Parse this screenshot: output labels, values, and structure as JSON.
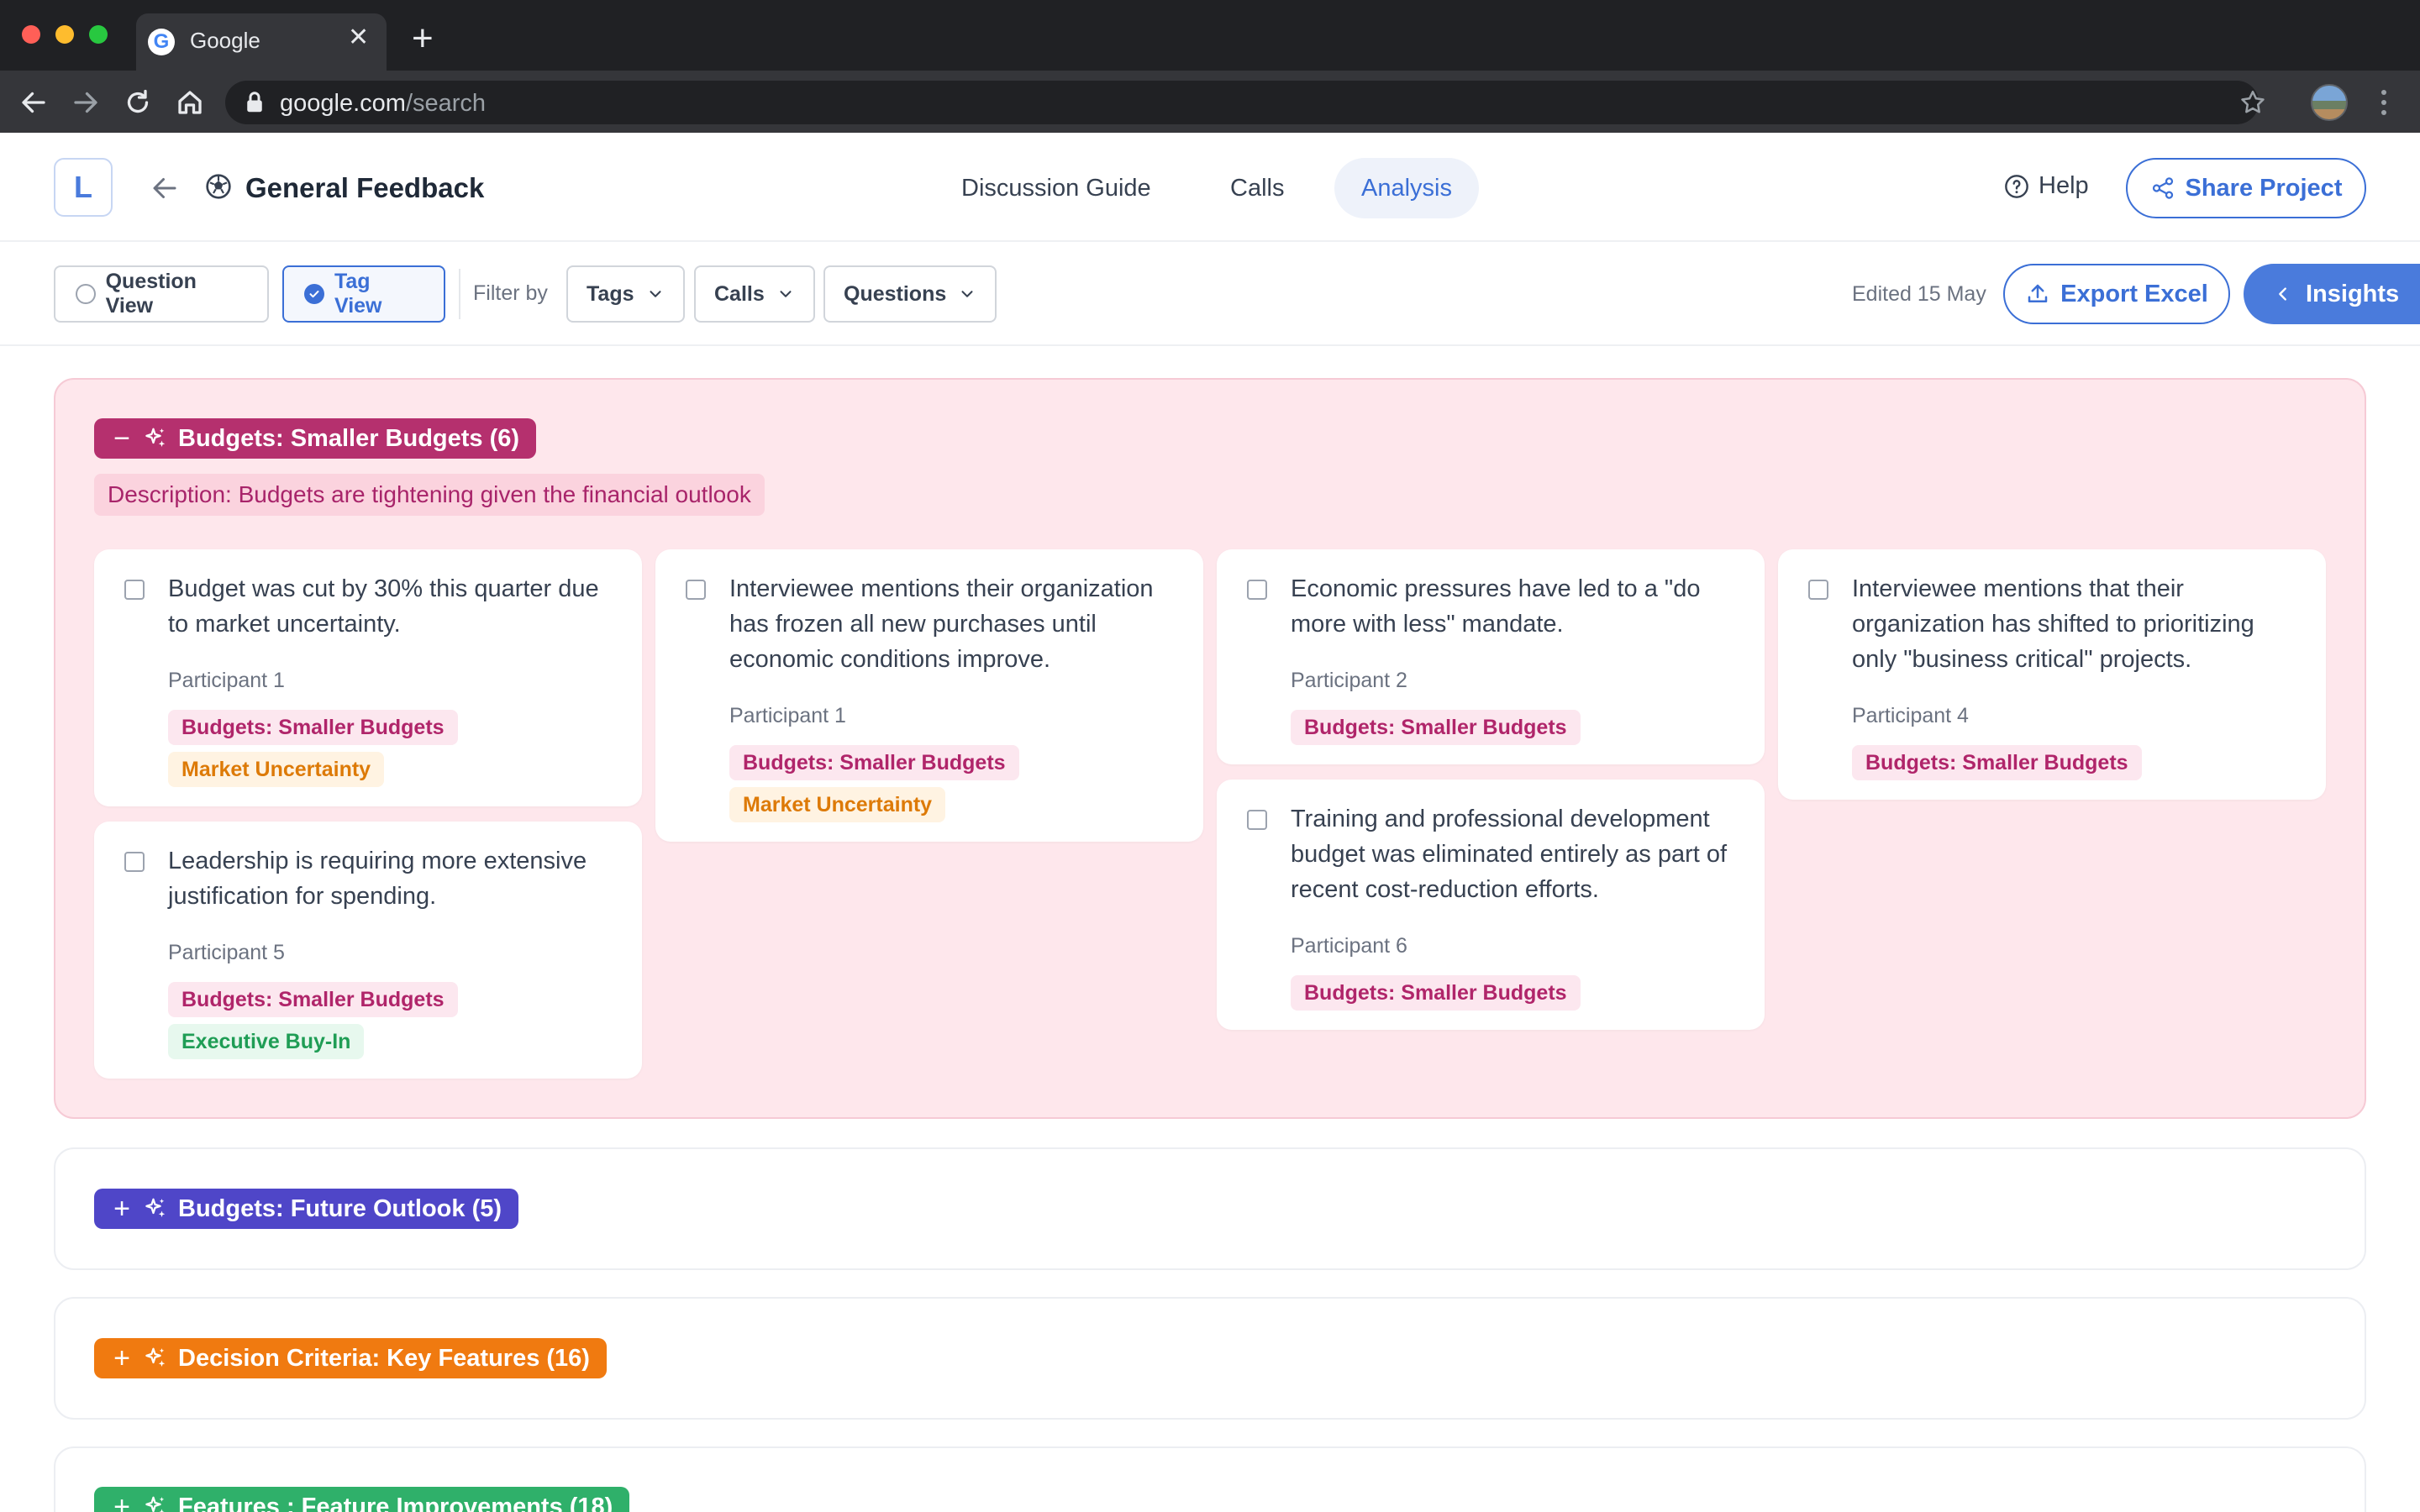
{
  "browser": {
    "tab_title": "Google",
    "url_host": "google.com",
    "url_path": "/search"
  },
  "header": {
    "logo_letter": "L",
    "project_title": "General Feedback",
    "tabs": [
      "Discussion Guide",
      "Calls",
      "Analysis"
    ],
    "active_tab": "Analysis",
    "help_label": "Help",
    "share_label": "Share Project"
  },
  "toolbar": {
    "view_question": "Question View",
    "view_tag": "Tag View",
    "selected_view": "Tag View",
    "filter_label": "Filter by",
    "filters": [
      "Tags",
      "Calls",
      "Questions"
    ],
    "edited": "Edited 15 May",
    "export_label": "Export Excel",
    "insights_label": "Insights"
  },
  "colors": {
    "accent": "#3b6fd6",
    "tag_smaller_budgets": "#b5306e",
    "tag_future_outlook": "#4f46c8",
    "tag_decision_criteria": "#f07a10",
    "tag_features": "#2fb06a"
  },
  "groups": [
    {
      "title": "Budgets: Smaller Budgets (6)",
      "expanded": true,
      "description": "Description: Budgets are tightening given the financial outlook",
      "cards": [
        {
          "quote": "Budget was cut by 30% this quarter due to market uncertainty.",
          "participant": "Participant 1",
          "tags": [
            "Budgets: Smaller Budgets",
            "Market Uncertainty"
          ]
        },
        {
          "quote": "Interviewee mentions their organization has frozen all new purchases until economic conditions improve.",
          "participant": "Participant 1",
          "tags": [
            "Budgets: Smaller Budgets",
            "Market Uncertainty"
          ]
        },
        {
          "quote": "Economic pressures have led to a \"do more with less\" mandate.",
          "participant": "Participant 2",
          "tags": [
            "Budgets: Smaller Budgets"
          ]
        },
        {
          "quote": "Interviewee mentions that their organization has shifted to prioritizing only \"business critical\" projects.",
          "participant": "Participant 4",
          "tags": [
            "Budgets: Smaller Budgets"
          ]
        },
        {
          "quote": "Leadership is requiring more extensive justification for spending.",
          "participant": "Participant 5",
          "tags": [
            "Budgets: Smaller Budgets",
            "Executive Buy-In"
          ]
        },
        {
          "quote": "Training and professional development budget was eliminated entirely as part of recent cost-reduction efforts.",
          "participant": "Participant 6",
          "tags": [
            "Budgets: Smaller Budgets"
          ]
        }
      ]
    },
    {
      "title": "Budgets: Future Outlook (5)",
      "expanded": false
    },
    {
      "title": "Decision Criteria: Key Features (16)",
      "expanded": false
    },
    {
      "title": "Features : Feature Improvements (18)",
      "expanded": false
    }
  ]
}
